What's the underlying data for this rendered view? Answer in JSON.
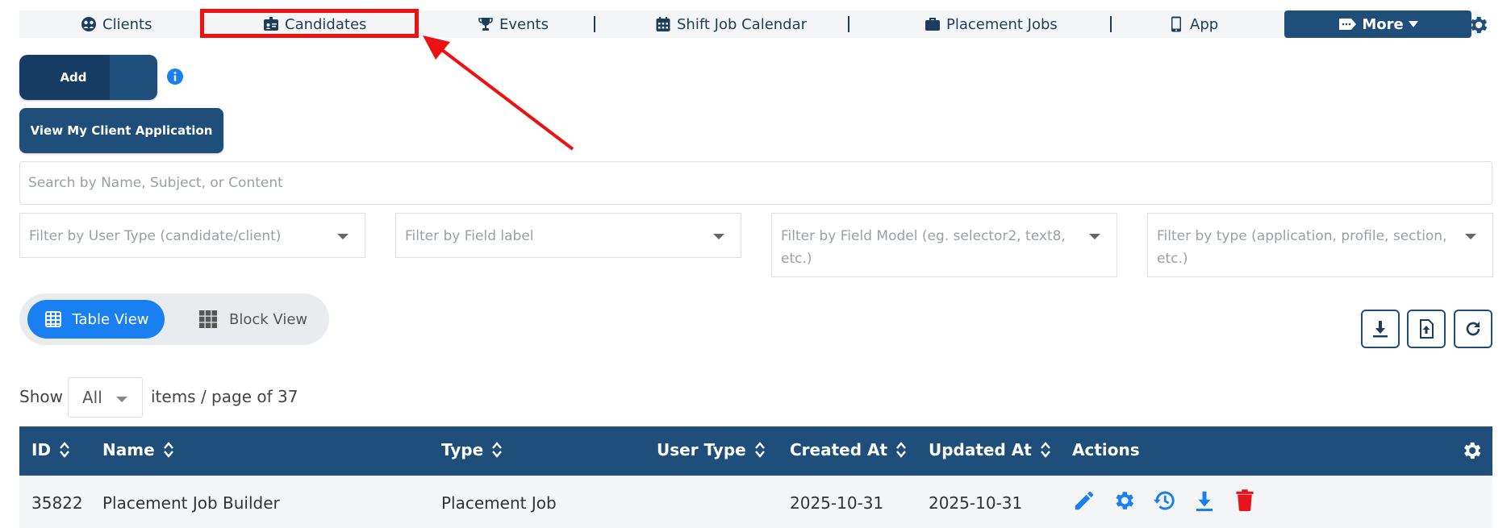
{
  "nav": {
    "items": [
      {
        "label": "Clients",
        "icon": "users-icon"
      },
      {
        "label": "Candidates",
        "icon": "id-badge-icon"
      },
      {
        "label": "Events",
        "icon": "trophy-icon"
      },
      {
        "label": "Shift Job Calendar",
        "icon": "calendar-icon"
      },
      {
        "label": "Placement Jobs",
        "icon": "briefcase-icon"
      },
      {
        "label": "App",
        "icon": "mobile-icon"
      }
    ],
    "more_label": "More",
    "highlighted": "Candidates"
  },
  "actions": {
    "add_label": "Add",
    "view_app_label": "View My Client Application"
  },
  "search": {
    "placeholder": "Search by Name, Subject, or Content"
  },
  "filters": [
    "Filter by User Type (candidate/client)",
    "Filter by Field label",
    "Filter by Field Model (eg. selector2, text8, etc.)",
    "Filter by type (application, profile, section, etc.)"
  ],
  "view_toggle": {
    "table_label": "Table View",
    "block_label": "Block View",
    "active": "Table View"
  },
  "pagination": {
    "show_label": "Show",
    "page_size": "All",
    "info": "items / page of 37"
  },
  "table": {
    "headers": [
      "ID",
      "Name",
      "Type",
      "User Type",
      "Created At",
      "Updated At",
      "Actions"
    ],
    "rows": [
      {
        "id": "35822",
        "name": "Placement Job Builder",
        "type": "Placement Job",
        "user_type": "",
        "created_at": "2025-10-31",
        "updated_at": "2025-10-31"
      }
    ]
  },
  "colors": {
    "primary": "#1e4e79",
    "accent": "#1a7ff0",
    "danger": "#e8141b",
    "annotation": "#ee1111"
  }
}
